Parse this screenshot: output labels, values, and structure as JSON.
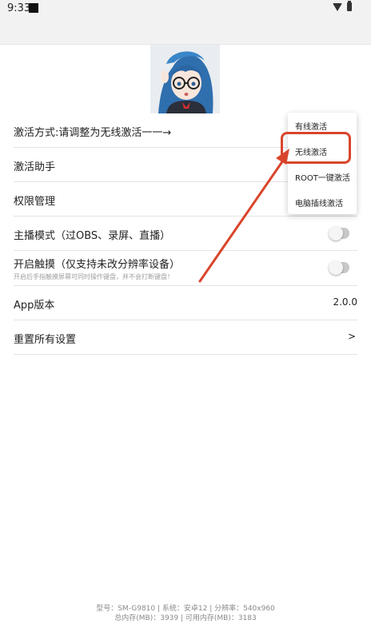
{
  "status_bar": {
    "time": "9:33",
    "icons": [
      "notification-square-icon",
      "wifi-icon",
      "battery-icon"
    ]
  },
  "avatar": {
    "description_icon": "anime-girl-avatar-icon"
  },
  "settings": [
    {
      "label": "激活方式:请调整为无线激活一一→"
    },
    {
      "label": "激活助手"
    },
    {
      "label": "权限管理"
    },
    {
      "label": "主播模式（过OBS、录屏、直播）",
      "toggle_on": false
    },
    {
      "label": "开启触摸（仅支持未改分辨率设备）",
      "sublabel": "开启后手指触摸屏幕可同时操作键盘，并不会打断键盘！",
      "toggle_on": false
    },
    {
      "label": "App版本",
      "value": "2.0.0"
    },
    {
      "label": "重置所有设置",
      "value": ">"
    }
  ],
  "menu": {
    "items": [
      "有线激活",
      "无线激活",
      "ROOT一键激活",
      "电脑插线激活"
    ],
    "highlighted_index": 1
  },
  "annotation": {
    "color": "#d9452b"
  },
  "footer": {
    "line1": "型号：SM-G9810 | 系统：安卓12 | 分辨率：540x960",
    "line2": "总内存(MB)：3939 | 可用内存(MB)：3183"
  }
}
